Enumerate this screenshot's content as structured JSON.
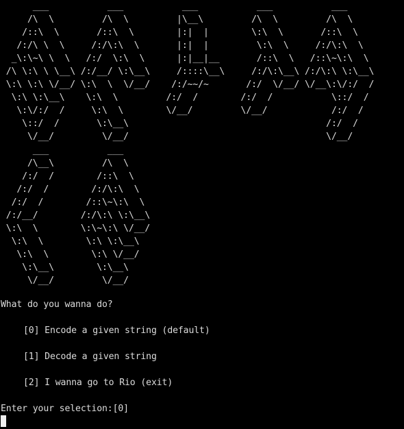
{
  "terminal": {
    "banner_top": "      ___           ___           ___           ___           ___\n     /\\  \\         /\\  \\         |\\__\\         /\\  \\         /\\  \\\n    /::\\  \\       /::\\  \\        |:|  |        \\:\\  \\       /::\\  \\\n   /:/\\ \\  \\     /:/\\:\\  \\       |:|  |         \\:\\  \\     /:/\\:\\  \\\n  _\\:\\~\\ \\  \\   /:/  \\:\\  \\      |:|__|__       /::\\  \\   /::\\~\\:\\  \\\n /\\ \\:\\ \\ \\__\\ /:/__/ \\:\\__\\     /::::\\__\\     /:/\\:\\__\\ /:/\\:\\ \\:\\__\\\n \\:\\ \\:\\ \\/__/ \\:\\  \\  \\/__/    /:/~~/~       /:/  \\/__/ \\/__\\:\\/:/  /\n  \\:\\ \\:\\__\\    \\:\\  \\         /:/  /        /:/  /           \\::/  /\n   \\:\\/:/  /     \\:\\  \\        \\/__/         \\/__/            /:/  /\n    \\::/  /       \\:\\__\\                                     /:/  /\n     \\/__/         \\/__/                                     \\/__/",
    "banner_bottom": "      ___           ___\n     /\\__\\         /\\  \\\n    /:/  /        /::\\  \\\n   /:/  /        /:/\\:\\  \\\n  /:/  /        /::\\~\\:\\  \\\n /:/__/        /:/\\:\\ \\:\\__\\\n \\:\\  \\        \\:\\~\\:\\ \\/__/\n  \\:\\  \\        \\:\\ \\:\\__\\\n   \\:\\  \\        \\:\\ \\/__/\n    \\:\\__\\        \\:\\__\\\n     \\/__/         \\/__/",
    "question": "What do you wanna do?",
    "options": [
      "[0] Encode a given string (default)",
      "[1] Decode a given string",
      "[2] I wanna go to Rio (exit)"
    ],
    "prompt": "Enter your selection:[0]"
  },
  "colors": {
    "background": "#000000",
    "foreground": "#dcdcdc",
    "cursor": "#f0f0f0"
  }
}
